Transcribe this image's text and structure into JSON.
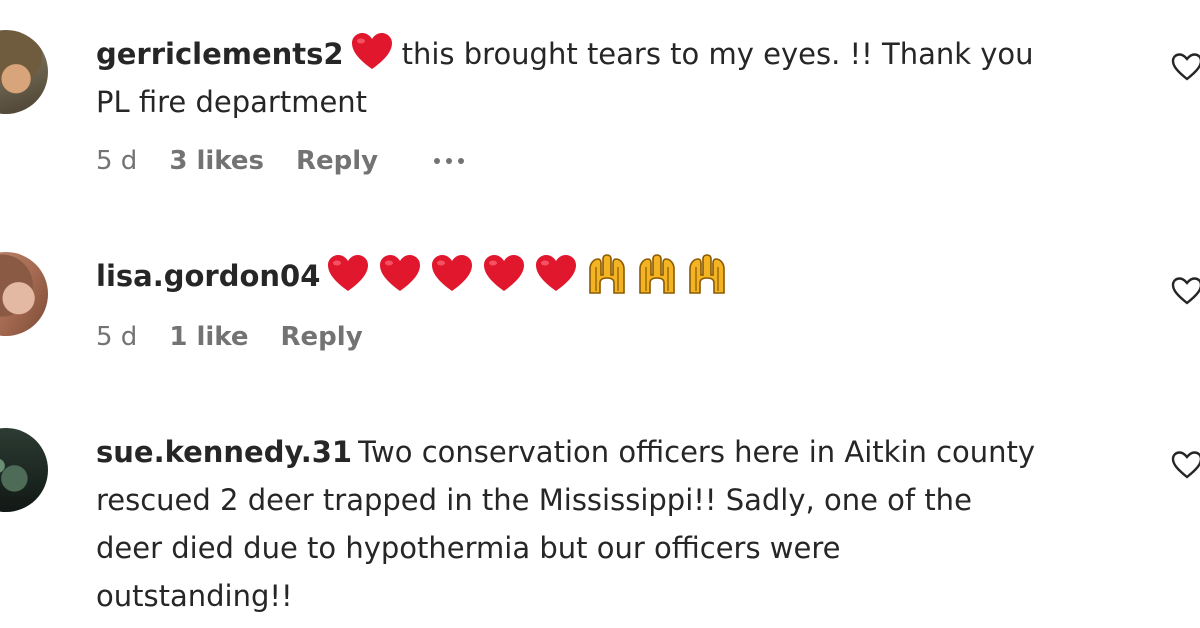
{
  "comments": [
    {
      "username": "gerriclements2",
      "text_after_emoji": "this brought tears to my eyes. !! Thank you",
      "text_line2": "PL fire department",
      "age": "5 d",
      "likes": "3 likes",
      "reply_label": "Reply",
      "emoji": [
        "heart"
      ]
    },
    {
      "username": "lisa.gordon04",
      "age": "5 d",
      "likes": "1 like",
      "reply_label": "Reply",
      "emoji": [
        "heart",
        "heart",
        "heart",
        "heart",
        "heart",
        "raising-hands",
        "raising-hands",
        "raising-hands"
      ]
    },
    {
      "username": "sue.kennedy.31",
      "line1": "Two conservation officers here in Aitkin county",
      "line2": "rescued 2 deer trapped in the Mississippi!! Sadly, one of the",
      "line3": "deer died due to hypothermia but our officers were",
      "line4": "outstanding!!"
    }
  ],
  "colors": {
    "text": "#262626",
    "meta": "#737373",
    "heart": "#e0172d",
    "hands": "#f3b323"
  },
  "icons": {
    "like": "heart-outline-icon",
    "more": "more-options-icon"
  }
}
